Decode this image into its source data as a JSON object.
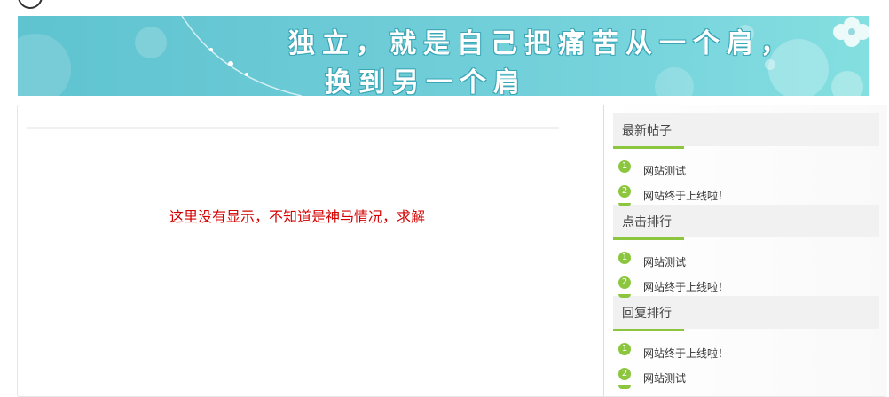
{
  "banner": {
    "line1": "独立，就是自己把痛苦从一个肩，",
    "line2": "换到另一个肩"
  },
  "main": {
    "message": "这里没有显示，不知道是神马情况，求解"
  },
  "sidebar": {
    "widgets": [
      {
        "title": "最新帖子",
        "items": [
          {
            "num": "1",
            "label": "网站测试"
          },
          {
            "num": "2",
            "label": "网站终于上线啦！"
          }
        ]
      },
      {
        "title": "点击排行",
        "items": [
          {
            "num": "1",
            "label": "网站测试"
          },
          {
            "num": "2",
            "label": "网站终于上线啦！"
          }
        ]
      },
      {
        "title": "回复排行",
        "items": [
          {
            "num": "1",
            "label": "网站终于上线啦！"
          },
          {
            "num": "2",
            "label": "网站测试"
          }
        ]
      }
    ]
  },
  "colors": {
    "accent": "#8cc63f",
    "message": "#d40000",
    "banner": "#6ccbd6"
  }
}
